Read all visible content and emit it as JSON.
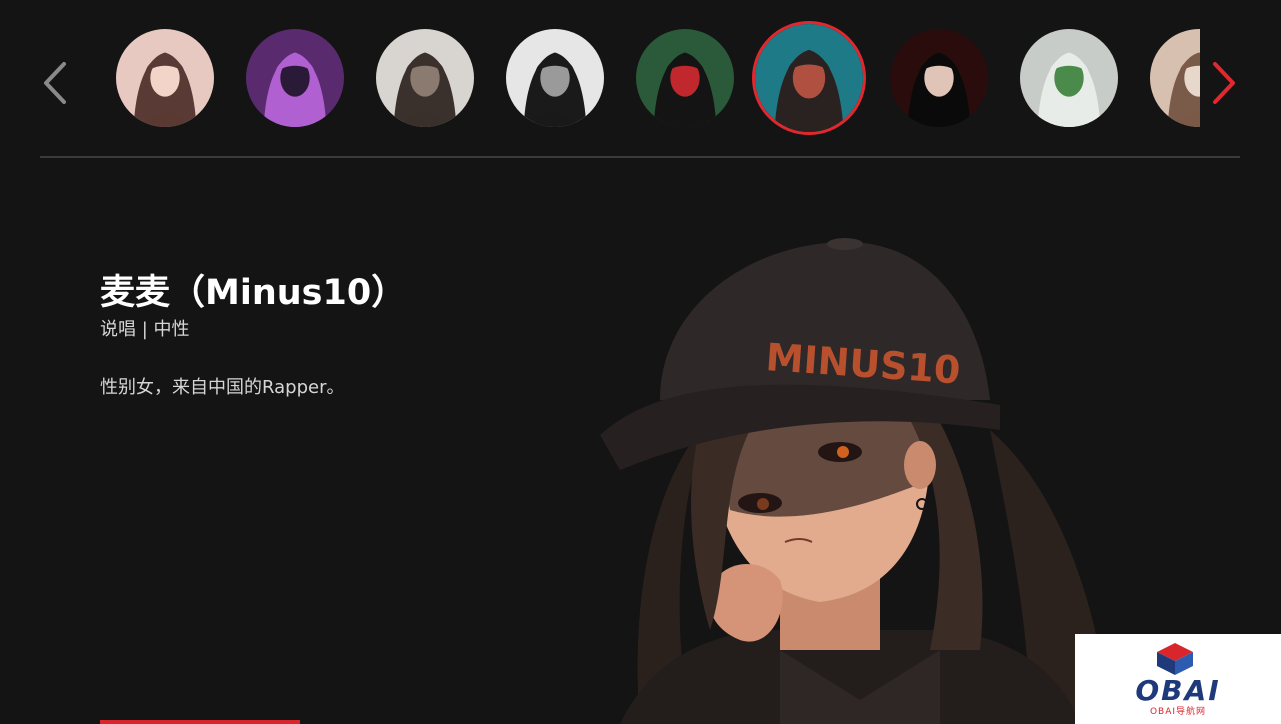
{
  "carousel": {
    "prev_icon": "chevron-left-icon",
    "next_icon": "chevron-right-icon",
    "next_color": "#e0282e",
    "prev_color": "#8a8a8a",
    "active_index": 5,
    "avatars": [
      {
        "name": "avatar-1",
        "colors": [
          "#e8c9c2",
          "#5a3a34",
          "#f2d4c8"
        ]
      },
      {
        "name": "avatar-2",
        "colors": [
          "#5a2a6e",
          "#b060d0",
          "#2a1a38"
        ]
      },
      {
        "name": "avatar-3",
        "colors": [
          "#d8d4d0",
          "#3a302c",
          "#8a7a70"
        ]
      },
      {
        "name": "avatar-4",
        "colors": [
          "#e6e6e6",
          "#1a1a1a",
          "#9a9a9a"
        ]
      },
      {
        "name": "avatar-5",
        "colors": [
          "#2a5a3a",
          "#141414",
          "#c0282e"
        ]
      },
      {
        "name": "avatar-6",
        "colors": [
          "#1e7a86",
          "#2a2220",
          "#b05040"
        ]
      },
      {
        "name": "avatar-7",
        "colors": [
          "#2a0c0c",
          "#0a0a0a",
          "#e0c4b8"
        ]
      },
      {
        "name": "avatar-8",
        "colors": [
          "#c8ccc8",
          "#e8ece8",
          "#4a8a4a"
        ]
      },
      {
        "name": "avatar-9",
        "colors": [
          "#d8c0b0",
          "#7a5a48",
          "#e8d8cc"
        ]
      }
    ]
  },
  "profile": {
    "name": "麦麦（Minus10）",
    "tags": "说唱 | 中性",
    "description": "性别女，来自中国的Rapper。",
    "cap_text": "MINUS10"
  },
  "logo": {
    "text": "OBAI",
    "subtitle": "OBAI导航网",
    "primary": "#1f3a7a",
    "accent": "#d9262c"
  },
  "colors": {
    "background": "#141414",
    "accent": "#d9262c"
  }
}
